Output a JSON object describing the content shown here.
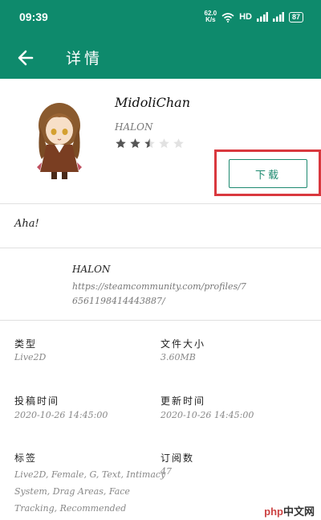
{
  "status_bar": {
    "time": "09:39",
    "net_speed_value": "62.0",
    "net_speed_unit": "K/s",
    "hd_label": "HD",
    "battery": "87"
  },
  "app_bar": {
    "title": "详情",
    "back_icon": "arrow-left-icon"
  },
  "app": {
    "name": "MidoliChan",
    "author": "HALON",
    "rating": 2.5,
    "rating_max": 5,
    "download_label": "下载"
  },
  "description": "Aha!",
  "creator": {
    "name": "HALON",
    "link": "https://steamcommunity.com/profiles/76561198414443887/"
  },
  "details": {
    "type_label": "类型",
    "type_value": "Live2D",
    "size_label": "文件大小",
    "size_value": "3.60MB",
    "submitted_label": "投稿时间",
    "submitted_value": "2020-10-26 14:45:00",
    "updated_label": "更新时间",
    "updated_value": "2020-10-26 14:45:00",
    "tags_label": "标签",
    "tags_value": "Live2D, Female, G, Text, Intimacy System, Drag Areas, Face Tracking, Recommended",
    "subs_label": "订阅数",
    "subs_value": "47"
  },
  "watermark": {
    "brand": "php",
    "suffix": "中文网"
  },
  "colors": {
    "primary": "#0e8a6c",
    "accent_button": "#1d8a70",
    "highlight": "#d9383e"
  }
}
